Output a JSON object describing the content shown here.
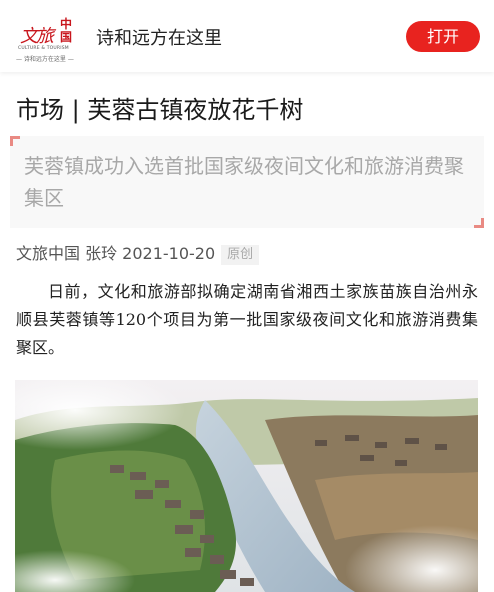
{
  "header": {
    "logo": {
      "calligraphy": "文旅",
      "seal": "中国",
      "english": "CULTURE & TOURISM",
      "sub": "— 诗和远方在这里 —"
    },
    "site_name": "诗和远方在这里",
    "open_button": "打开"
  },
  "article": {
    "title": "市场 | 芙蓉古镇夜放花千树",
    "summary": "芙蓉镇成功入选首批国家级夜间文化和旅游消费聚集区",
    "byline": "文旅中国 张玲 2021-10-20",
    "badge": "原创",
    "paragraph": "日前，文化和旅游部拟确定湖南省湘西土家族苗族自治州永顺县芙蓉镇等120个项目为第一批国家级夜间文化和旅游消费集聚区。"
  },
  "colors": {
    "brand_red": "#e8231f",
    "quote_corner": "#e98a83"
  },
  "image": {
    "subject": "aerial-town-river-photo"
  }
}
